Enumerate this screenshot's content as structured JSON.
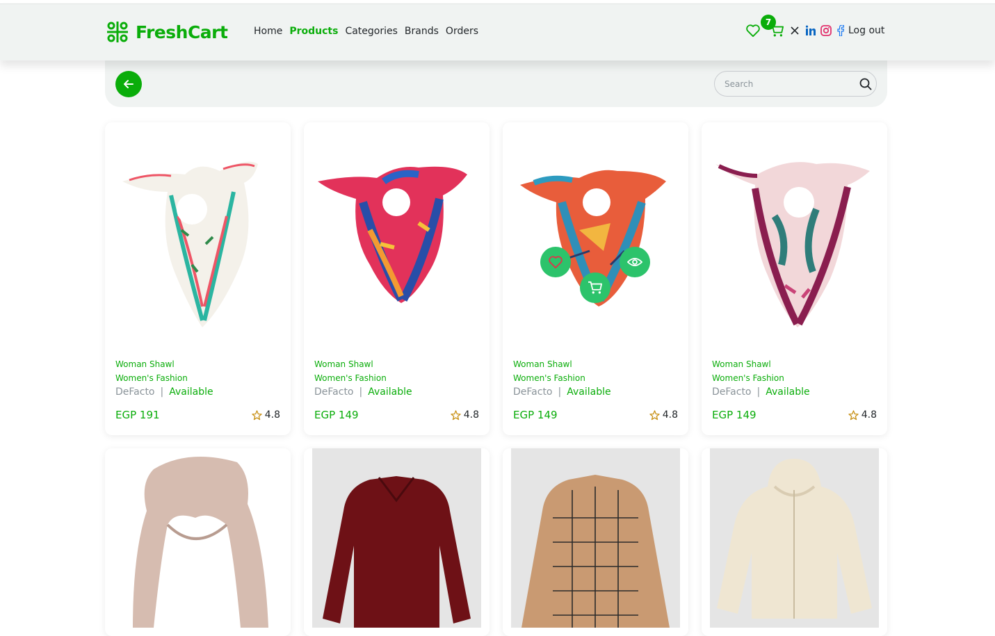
{
  "navbar": {
    "brand": "FreshCart",
    "links": [
      "Home",
      "Products",
      "Categories",
      "Brands",
      "Orders"
    ],
    "active_link": "Products",
    "cart_count": "7",
    "logout_label": "Log out"
  },
  "subbar": {
    "search_placeholder": "Search"
  },
  "products": [
    {
      "category": "Woman Shawl",
      "subcategory": "Women's Fashion",
      "brand": "DeFacto",
      "status": "Available",
      "price": "EGP 191",
      "rating": "4.8"
    },
    {
      "category": "Woman Shawl",
      "subcategory": "Women's Fashion",
      "brand": "DeFacto",
      "status": "Available",
      "price": "EGP 149",
      "rating": "4.8"
    },
    {
      "category": "Woman Shawl",
      "subcategory": "Women's Fashion",
      "brand": "DeFacto",
      "status": "Available",
      "price": "EGP 149",
      "rating": "4.8"
    },
    {
      "category": "Woman Shawl",
      "subcategory": "Women's Fashion",
      "brand": "DeFacto",
      "status": "Available",
      "price": "EGP 149",
      "rating": "4.8"
    }
  ],
  "colors": {
    "accent": "#0aad0a",
    "navbar_bg": "#f0f3f2",
    "hover_button": "#2cc36b"
  },
  "icons": [
    "logo-icon",
    "heart-icon",
    "cart-icon",
    "x-twitter-icon",
    "linkedin-icon",
    "instagram-icon",
    "facebook-icon",
    "arrow-left-icon",
    "search-icon",
    "star-icon",
    "eye-icon"
  ]
}
